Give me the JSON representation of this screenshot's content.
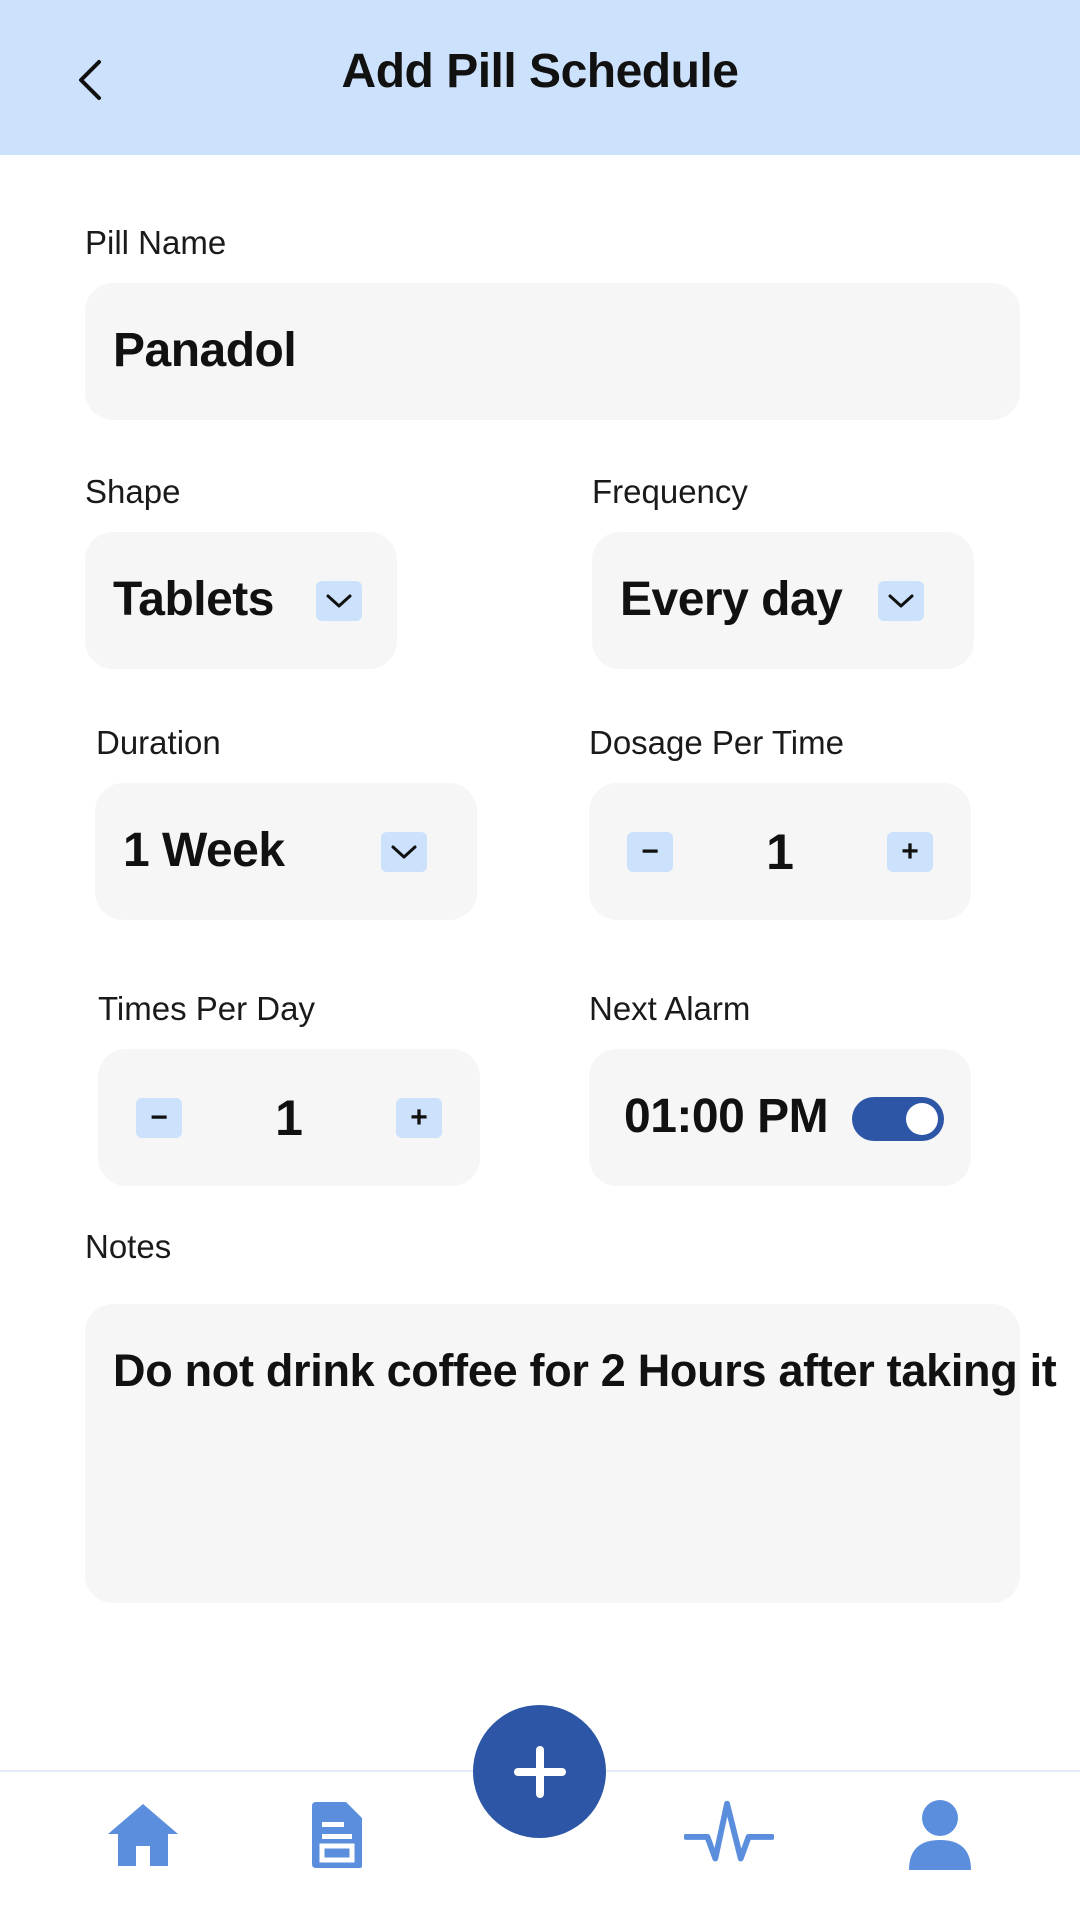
{
  "header": {
    "title": "Add Pill Schedule",
    "back_icon": "chevron-left-icon"
  },
  "pill_name": {
    "label": "Pill Name",
    "value": "Panadol"
  },
  "shape": {
    "label": "Shape",
    "value": "Tablets",
    "icon": "chevron-down-icon"
  },
  "frequency": {
    "label": "Frequency",
    "value": "Every day",
    "icon": "chevron-down-icon"
  },
  "duration": {
    "label": "Duration",
    "value": "1 Week",
    "icon": "chevron-down-icon"
  },
  "dosage": {
    "label": "Dosage Per Time",
    "value": "1",
    "minus": "−",
    "plus": "+"
  },
  "times_per_day": {
    "label": "Times Per Day",
    "value": "1",
    "minus": "−",
    "plus": "+"
  },
  "next_alarm": {
    "label": "Next Alarm",
    "value": "01:00 PM",
    "enabled": true
  },
  "notes": {
    "label": "Notes",
    "value": "Do not drink coffee for 2 Hours after taking it"
  },
  "bottom_nav": {
    "items": [
      "home-icon",
      "document-icon",
      "add-icon",
      "activity-icon",
      "profile-icon"
    ]
  },
  "colors": {
    "header_bg": "#cce1fb",
    "accent": "#2d56a6",
    "nav_icon": "#5b8fde",
    "field_bg": "#f6f6f6"
  }
}
